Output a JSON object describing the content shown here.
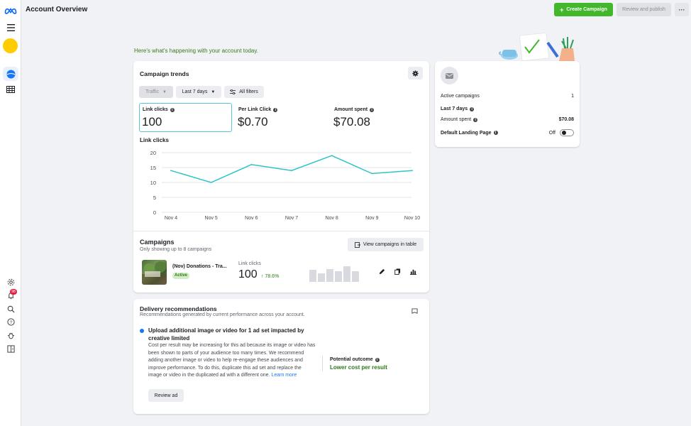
{
  "header": {
    "title": "Account Overview",
    "create_label": "Create Campaign",
    "review_publish_label": "Review and publish",
    "more_label": "···"
  },
  "greeting": "Here's what's happening with your account today.",
  "notifications": {
    "count": "98"
  },
  "trends": {
    "title": "Campaign trends",
    "filters": {
      "objective": "Traffic",
      "range": "Last 7 days",
      "all_filters": "All filters"
    },
    "metrics": [
      {
        "label": "Link clicks",
        "value": "100"
      },
      {
        "label": "Per Link Click",
        "value": "$0.70"
      },
      {
        "label": "Amount spent",
        "value": "$70.08"
      }
    ],
    "chart_title": "Link clicks"
  },
  "chart_data": {
    "type": "line",
    "categories": [
      "Nov 4",
      "Nov 5",
      "Nov 6",
      "Nov 7",
      "Nov 8",
      "Nov 9",
      "Nov 10"
    ],
    "series": [
      {
        "values": [
          14,
          10,
          16,
          14,
          19,
          13,
          14
        ]
      }
    ],
    "ylim": [
      0,
      20
    ],
    "yticks": [
      0,
      5,
      10,
      15,
      20
    ],
    "title": "Link clicks",
    "grid": true,
    "color": "#2ec4c8"
  },
  "campaigns": {
    "title": "Campaigns",
    "subtitle": "Only showing up to 8 campaigns",
    "view_table_label": "View campaigns in table",
    "rows": [
      {
        "name": "(Nov) Donations - Tra...",
        "status": "Active",
        "metric_label": "Link clicks",
        "metric_value": "100",
        "delta": "78.6%"
      }
    ]
  },
  "summary": {
    "active_campaigns_label": "Active campaigns",
    "active_campaigns_value": "1",
    "range_label": "Last 7 days",
    "amount_spent_label": "Amount spent",
    "amount_spent_value": "$70.08",
    "landing_page_label": "Default Landing Page",
    "landing_page_state": "Off"
  },
  "delivery": {
    "title": "Delivery recommendations",
    "subtitle": "Recommendations generated by current performance across your account.",
    "rec_title": "Upload additional image or video for 1 ad set impacted by creative limited",
    "rec_body": "Cost per result may be increasing for this ad because its image or video has been shown to parts of your audience too many times. We recommend adding another image or video to help re-engage these audiences and improve performance. To do this, duplicate this ad set and replace the image or video in the duplicated ad with a different one.",
    "learn_more": "Learn more",
    "review_ad_label": "Review ad",
    "outcome_label": "Potential outcome",
    "outcome_value": "Lower cost per result"
  },
  "colors": {
    "accent_green": "#42b72a",
    "brand_blue": "#1877f2",
    "chart_line": "#2ec4c8",
    "positive": "#2b7a18"
  }
}
